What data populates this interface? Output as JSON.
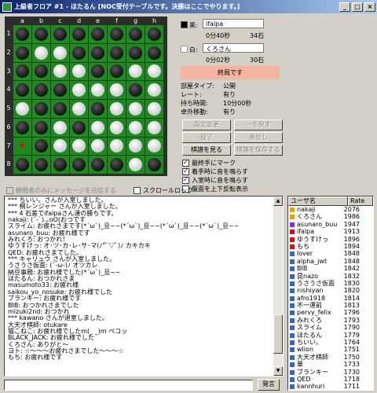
{
  "window": {
    "title": "上級者フロア #1 - ほたるん [NOC受付テーブルです。決勝はここでやります。]",
    "min": "_",
    "max": "□",
    "close": "×"
  },
  "board": {
    "cols": [
      "a",
      "b",
      "c",
      "d",
      "e",
      "f",
      "g",
      "h"
    ],
    "rows": [
      "1",
      "2",
      "3",
      "4",
      "5",
      "6",
      "7",
      "8"
    ],
    "grid": [
      "BBBBBBBB",
      "BWWBBBBB",
      "BBWWBBWW",
      "BBBWWWBW",
      "WBBWBWWW",
      "BBWBWWWW",
      ".BWWWWWW",
      "BBBBBBWB"
    ],
    "cursor_symbol": "+"
  },
  "players": {
    "black": {
      "label": "黒:",
      "name": "ifalpa",
      "time": "0分40秒",
      "stones": "34石",
      "color": "#000000"
    },
    "white": {
      "label": "白:",
      "name": "くろさん",
      "time": "0分02秒",
      "stones": "30石",
      "color": "#ffffff"
    }
  },
  "status": "終局です",
  "info": [
    {
      "label": "部屋タイプ:",
      "value": "公開"
    },
    {
      "label": "レート:",
      "value": "有り"
    },
    {
      "label": "持ち時間:",
      "value": "10分00秒"
    },
    {
      "label": "卓外移動:",
      "value": "有り"
    }
  ],
  "buttons": {
    "settings": "設定変更",
    "undo": "一手戻す",
    "resign": "投了",
    "leave": "退出し",
    "review": "棋譜を見る",
    "save": "棋譜を保存する"
  },
  "options": {
    "mark_last": "最終手にマーク",
    "sound_move": "着手時に音を鳴らす",
    "sound_enter": "入室時に音を鳴らす",
    "flip_board": "盤面を上下反転表示"
  },
  "side": {
    "spectators_only": "観戦者のみにメッセージを送信する",
    "scroll_lock": "スクロールロック"
  },
  "chat": [
    "*** ちいい。さんが入室しました。",
    "*** 桐レンジャー さんが入室しました。",
    "*** 4 石差でifalpaさん達の勝ちです。",
    "nakaji: (´-`).｡oO(おつです",
    "スライム: お疲れさまです(*´ω`)_旦~~(*´ω`)_旦~~(*´ω`)_旦~~(*´ω`)_旦~~",
    "asunaro_buu: お疲れ様です",
    "みれくろ: おつかれ！",
    "ゆうすけっ: オ･ツ･カ･レ･サ･マ(ﾉ*ﾟ▽ﾟ)ﾉ カキカキ",
    "QED: お疲れさまでした。",
    "*** キャリュウ さんが入室しました。",
    "うさうさ仮面: (`-ω-)ﾉ オツカレ",
    "納豆事務: お疲れ様でした(*´ω`)_旦~~",
    "ほたるん: おつかれさま",
    "masumoto33: お疲れ様",
    "saikou_yo_nosuke: お疲れ様でした",
    "ブランキー: お疲れ様です",
    "BIB: おつかれさまでした",
    "mizuki2nd: おつかれ",
    "*** kawano さんが退室しました。",
    "大天才棋師: otukare",
    "猫こねこ: お疲れ様でしたm(_ _)m ペコッ",
    "BLACK_JACK: お疲れ様でした",
    "くろさん: ありがと～",
    "ヨト: ☆～～～お疲れさまでした～～～☆",
    "もち: お疲れ様です"
  ],
  "users": {
    "headers": {
      "name": "ユーザ名",
      "rate": "Rate"
    },
    "list": [
      {
        "name": "nakaji",
        "rate": "2076",
        "color": "#e8a000"
      },
      {
        "name": "くろさん",
        "rate": "1986",
        "color": "#e8a000"
      },
      {
        "name": "asunaro_buu",
        "rate": "1947",
        "color": "#8a2be2"
      },
      {
        "name": "ifalpa",
        "rate": "1913",
        "color": "#d01010"
      },
      {
        "name": "ゆうすけっ",
        "rate": "1896",
        "color": "#d01010"
      },
      {
        "name": "もち",
        "rate": "1894",
        "color": "#d01010"
      },
      {
        "name": "lover",
        "rate": "1848",
        "color": "#3366cc"
      },
      {
        "name": "alpha_jwt",
        "rate": "1848",
        "color": "#3366cc"
      },
      {
        "name": "BIB",
        "rate": "1842",
        "color": "#3366cc"
      },
      {
        "name": "昆nazo",
        "rate": "1832",
        "color": "#3366cc"
      },
      {
        "name": "うさうさ仮面",
        "rate": "1830",
        "color": "#3366cc"
      },
      {
        "name": "nishiyan",
        "rate": "1820",
        "color": "#3366cc"
      },
      {
        "name": "afro1918",
        "rate": "1814",
        "color": "#3366cc"
      },
      {
        "name": "不一運前",
        "rate": "1813",
        "color": "#3366cc"
      },
      {
        "name": "pervy_felix",
        "rate": "1796",
        "color": "#3366cc"
      },
      {
        "name": "みれくろ",
        "rate": "1793",
        "color": "#3366cc"
      },
      {
        "name": "スライム",
        "rate": "1790",
        "color": "#3366cc"
      },
      {
        "name": "ほたるん",
        "rate": "1779",
        "color": "#3366cc"
      },
      {
        "name": "ちいい。",
        "rate": "1764",
        "color": "#3366cc"
      },
      {
        "name": "wlion",
        "rate": "1751",
        "color": "#3366cc"
      },
      {
        "name": "大天才棋師",
        "rate": "1750",
        "color": "#3366cc"
      },
      {
        "name": "華",
        "rate": "1733",
        "color": "#3366cc"
      },
      {
        "name": "ブランキー",
        "rate": "1730",
        "color": "#3366cc"
      },
      {
        "name": "QED",
        "rate": "1718",
        "color": "#3366cc"
      },
      {
        "name": "kannhuri",
        "rate": "1711",
        "color": "#3366cc"
      }
    ]
  },
  "send_button": "発言"
}
